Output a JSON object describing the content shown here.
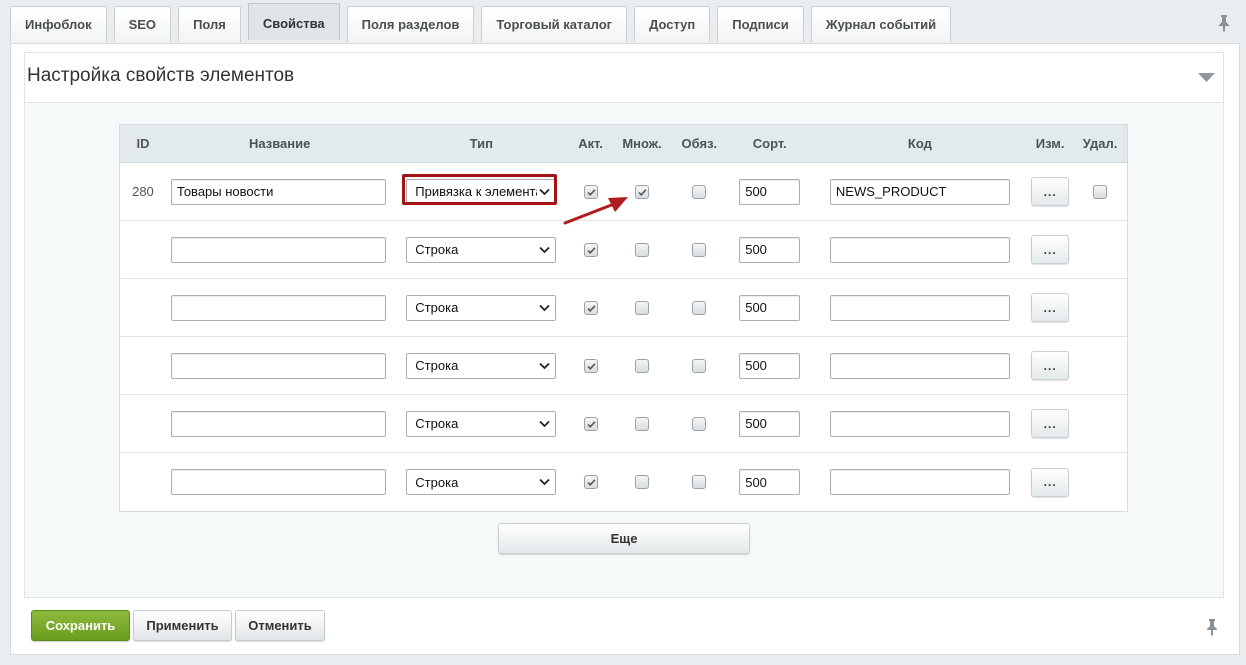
{
  "tabs": [
    {
      "label": "Инфоблок",
      "active": false
    },
    {
      "label": "SEO",
      "active": false
    },
    {
      "label": "Поля",
      "active": false
    },
    {
      "label": "Свойства",
      "active": true
    },
    {
      "label": "Поля разделов",
      "active": false
    },
    {
      "label": "Торговый каталог",
      "active": false
    },
    {
      "label": "Доступ",
      "active": false
    },
    {
      "label": "Подписи",
      "active": false
    },
    {
      "label": "Журнал событий",
      "active": false
    }
  ],
  "section": {
    "title": "Настройка свойств элементов"
  },
  "table": {
    "headers": {
      "id": "ID",
      "name": "Название",
      "type": "Тип",
      "akt": "Акт.",
      "mnozh": "Множ.",
      "obyaz": "Обяз.",
      "sort": "Сорт.",
      "code": "Код",
      "edit": "Изм.",
      "del": "Удал."
    },
    "rows": [
      {
        "id": "280",
        "name": "Товары новости",
        "type": "Привязка к элементам",
        "akt": true,
        "mnozh": true,
        "obyaz": false,
        "sort": "500",
        "code": "NEWS_PRODUCT",
        "edit": "...",
        "has_delete": true,
        "delete": false
      },
      {
        "id": "",
        "name": "",
        "type": "Строка",
        "akt": true,
        "mnozh": false,
        "obyaz": false,
        "sort": "500",
        "code": "",
        "edit": "...",
        "has_delete": false
      },
      {
        "id": "",
        "name": "",
        "type": "Строка",
        "akt": true,
        "mnozh": false,
        "obyaz": false,
        "sort": "500",
        "code": "",
        "edit": "...",
        "has_delete": false
      },
      {
        "id": "",
        "name": "",
        "type": "Строка",
        "akt": true,
        "mnozh": false,
        "obyaz": false,
        "sort": "500",
        "code": "",
        "edit": "...",
        "has_delete": false
      },
      {
        "id": "",
        "name": "",
        "type": "Строка",
        "akt": true,
        "mnozh": false,
        "obyaz": false,
        "sort": "500",
        "code": "",
        "edit": "...",
        "has_delete": false
      },
      {
        "id": "",
        "name": "",
        "type": "Строка",
        "akt": true,
        "mnozh": false,
        "obyaz": false,
        "sort": "500",
        "code": "",
        "edit": "...",
        "has_delete": false
      }
    ]
  },
  "more_label": "Еще",
  "footer": {
    "save_label": "Сохранить",
    "apply_label": "Применить",
    "cancel_label": "Отменить"
  },
  "colors": {
    "save_button": "#7aab2a",
    "highlight_border": "#a31416",
    "annotation_arrow": "#b01c1e",
    "header_bg": "#e3eaed"
  },
  "icons": {
    "pin": "pin-icon",
    "collapse": "chevron-down-icon",
    "select_arrow": "chevron-down-icon",
    "check": "check-icon"
  }
}
